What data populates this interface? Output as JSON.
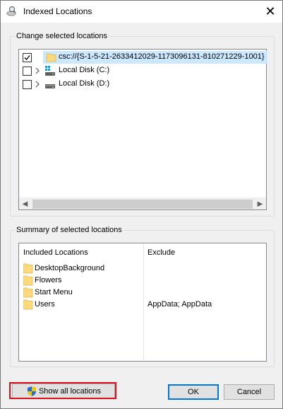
{
  "window": {
    "title": "Indexed Locations",
    "close_glyph": "✕"
  },
  "change_group": {
    "label": "Change selected locations",
    "items": [
      {
        "label": "csc://{S-1-5-21-2633412029-1173096131-810271229-1001}",
        "checked": true,
        "selected": true,
        "icon": "folder-icon"
      },
      {
        "label": "Local Disk (C:)",
        "checked": false,
        "selected": false,
        "icon": "windows-drive-icon"
      },
      {
        "label": "Local Disk (D:)",
        "checked": false,
        "selected": false,
        "icon": "drive-icon"
      }
    ],
    "scroll_left": "◀",
    "scroll_right": "▶"
  },
  "summary_group": {
    "label": "Summary of selected locations",
    "columns": {
      "included": "Included Locations",
      "exclude": "Exclude"
    },
    "rows": [
      {
        "name": "DesktopBackground",
        "exclude": ""
      },
      {
        "name": "Flowers",
        "exclude": ""
      },
      {
        "name": "Start Menu",
        "exclude": ""
      },
      {
        "name": "Users",
        "exclude": "AppData; AppData"
      }
    ]
  },
  "buttons": {
    "show_all": "Show all locations",
    "ok": "OK",
    "cancel": "Cancel"
  },
  "colors": {
    "selection": "#cce8ff",
    "highlight": "#e0101a",
    "folder": "#fcd97c"
  }
}
